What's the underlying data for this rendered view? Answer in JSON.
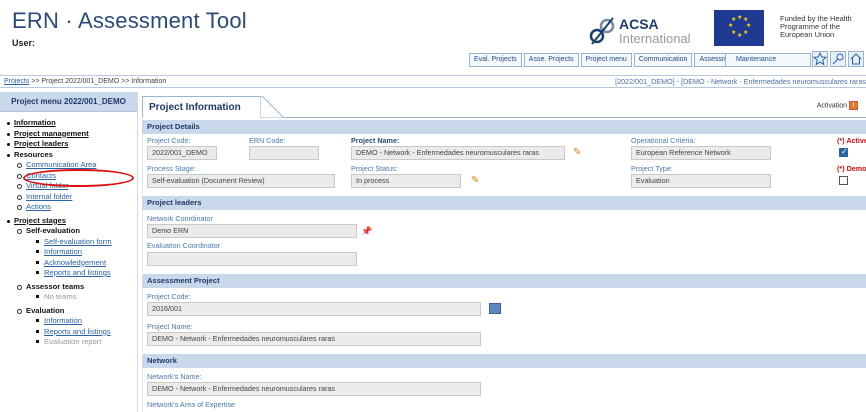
{
  "header": {
    "title": "ERN · Assessment Tool",
    "user_label": "User:",
    "acsa_name": "ACSA",
    "acsa_sub": "International",
    "eu_text": "Funded by the Health Programme of the European Union"
  },
  "nav": {
    "tabs": [
      "Eval. Projects",
      "Asse. Projects",
      "Project menu",
      "Communication",
      "Assessments"
    ],
    "maintenance": "Maintenance"
  },
  "breadcrumb": {
    "link": "Projects",
    "rest": " >> Project 2022/001_DEMO >> Information",
    "right": "[2022/001_DEMO] - [DEMO - Network - Enfermedades neuromusculares raras"
  },
  "sidebar": {
    "header": "Project menu 2022/001_DEMO",
    "information": "Information",
    "project_management": "Project management",
    "project_leaders": "Project leaders",
    "resources": "Resources",
    "communication_area": "Communication Area",
    "contacts": "Contacts",
    "virtual_folder": "Virtual folder",
    "internal_folder": "Internal folder",
    "actions": "Actions",
    "project_stages": "Project stages",
    "self_evaluation": "Self-evaluation",
    "self_evaluation_form": "Self-evaluation form",
    "se_information": "Information",
    "acknowledgement": "Acknowledgement",
    "reports_listings": "Reports and listings",
    "assessor_teams": "Assessor teams",
    "no_teams": "No teams",
    "evaluation": "Evaluation",
    "ev_information": "Information",
    "ev_reports": "Reports and listings",
    "evaluation_report": "Evaluation report"
  },
  "main": {
    "tab_title": "Project Information",
    "activation": "Activation",
    "sections": {
      "details": "Project Details",
      "leaders": "Project leaders",
      "assessment": "Assessment Project",
      "network": "Network"
    },
    "details": {
      "project_code_label": "Project Code:",
      "project_code": "2022/001_DEMO",
      "ern_code_label": "ERN Code:",
      "ern_code": "",
      "project_name_label": "Project Name:",
      "project_name": "DEMO - Network - Enfermedades neuromusculares raras",
      "op_criteria_label": "Operational Criteria:",
      "op_criteria": "European Reference Network",
      "active_label": "(*) Active",
      "process_stage_label": "Process Stage:",
      "process_stage": "Self-evaluation (Document Review)",
      "project_status_label": "Project Status:",
      "project_status": "In process",
      "project_type_label": "Project Type:",
      "project_type": "Evaluation",
      "demo_label": "(*) Demo"
    },
    "leaders": {
      "network_coordinator_label": "Network Coordinator",
      "network_coordinator": "Demo ERN",
      "evaluation_coordinator_label": "Evaluation Coordinator",
      "evaluation_coordinator": ""
    },
    "assessment": {
      "project_code_label": "Project Code:",
      "project_code": "2016/001",
      "project_name_label": "Project Name:",
      "project_name": "DEMO - Network - Enfermedades neuromusculares raras"
    },
    "network": {
      "name_label": "Network's Name:",
      "name": "DEMO - Network - Enfermedades neuromusculares raras",
      "area_label": "Network's Area of Expertise"
    }
  },
  "colors": {
    "accent": "#1e3a68",
    "section_bg": "#c9d8ea",
    "link": "#2b62a8",
    "highlight_oval": "#dd1111"
  }
}
